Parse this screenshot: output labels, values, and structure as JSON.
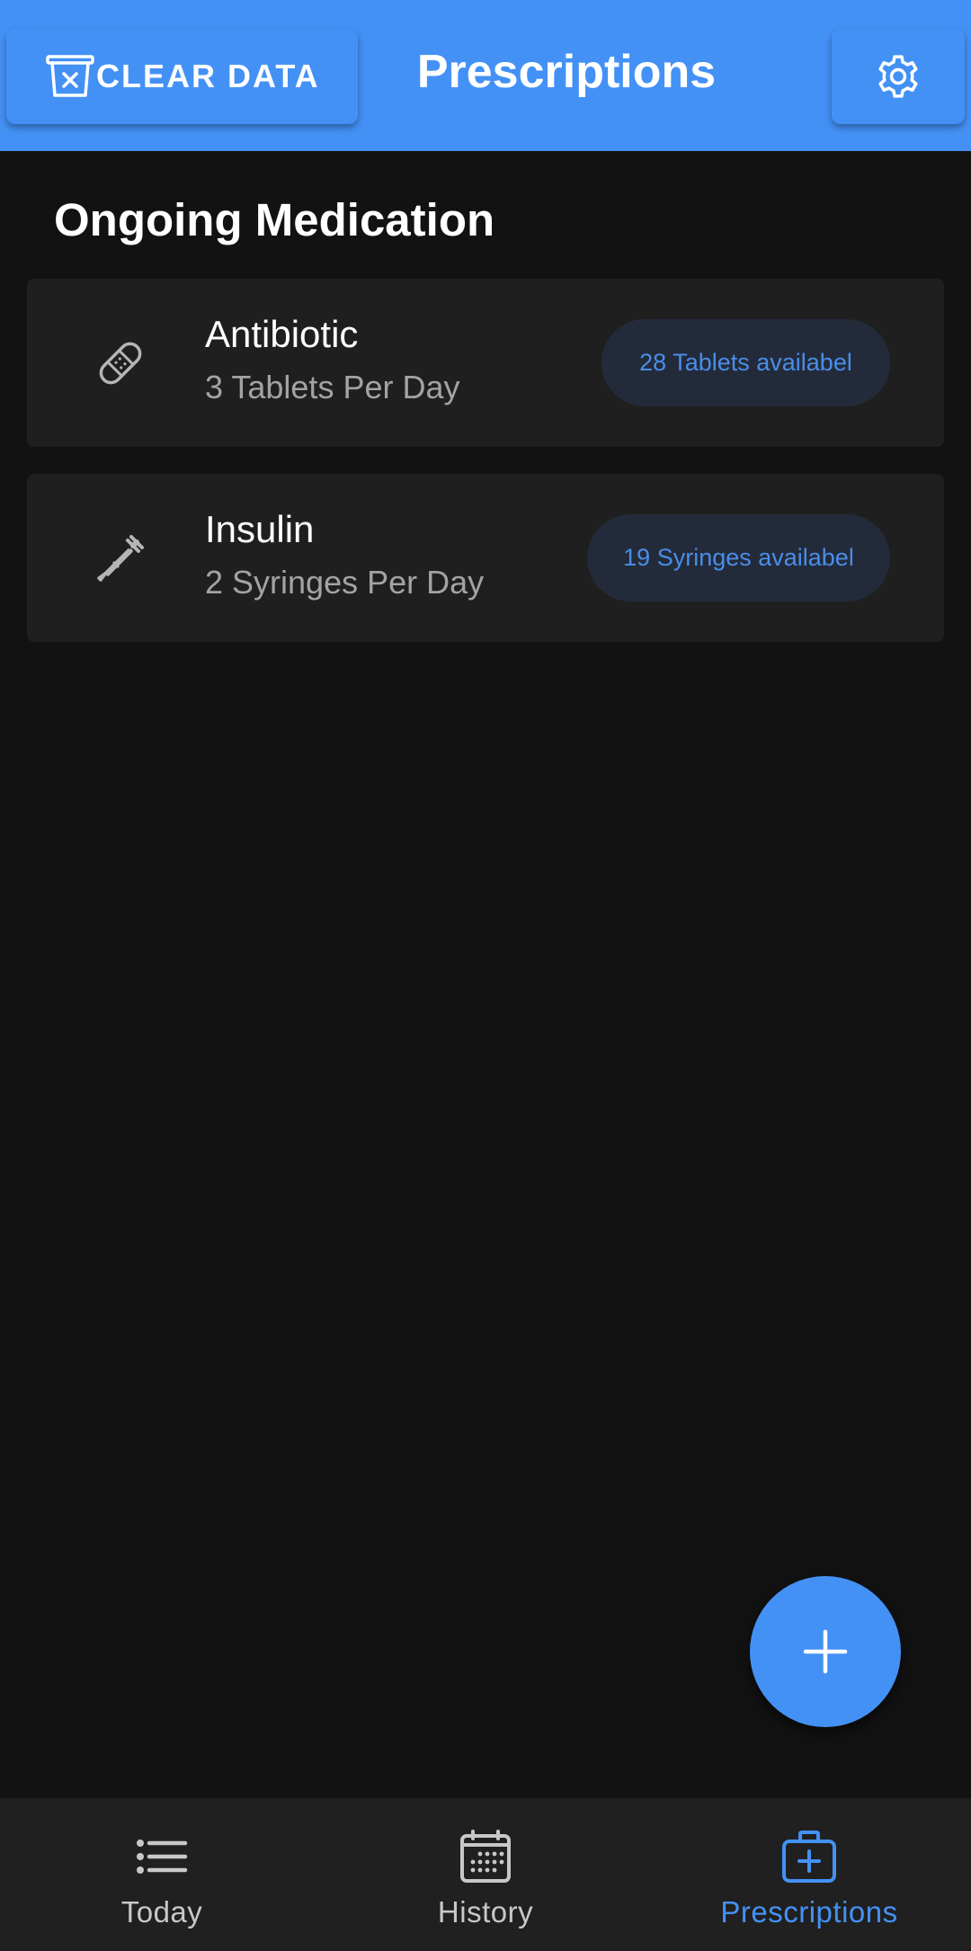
{
  "header": {
    "clear_label": "CLEAR DATA",
    "title": "Prescriptions"
  },
  "section_title": "Ongoing Medication",
  "medications": [
    {
      "name": "Antibiotic",
      "dose": "3 Tablets Per Day",
      "availability": "28 Tablets availabel",
      "icon": "bandage-icon"
    },
    {
      "name": "Insulin",
      "dose": "2 Syringes Per Day",
      "availability": "19 Syringes availabel",
      "icon": "dropper-icon"
    }
  ],
  "nav": {
    "today": "Today",
    "history": "History",
    "prescriptions": "Prescriptions",
    "active": "prescriptions"
  },
  "colors": {
    "accent": "#4491f6",
    "background": "#121212",
    "card": "#1f1f1f",
    "pill_bg": "#232b3a",
    "pill_text": "#4a8de8"
  }
}
